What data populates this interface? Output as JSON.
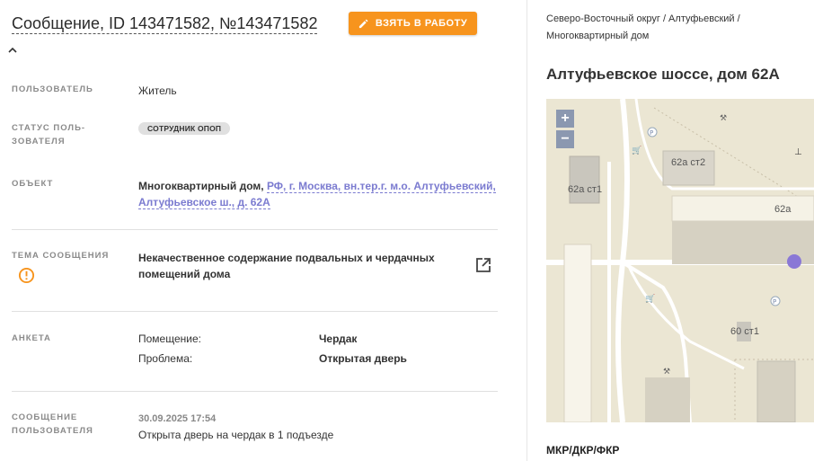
{
  "header": {
    "title": "Сообщение, ID 143471582, №143471582",
    "take_button": "ВЗЯТЬ В РАБОТУ"
  },
  "fields": {
    "user_label": "ПОЛЬЗОВАТЕЛЬ",
    "user_value": "Житель",
    "status_label_1": "СТАТУС ПОЛЬ-",
    "status_label_2": "ЗОВАТЕЛЯ",
    "status_badge": "СОТРУДНИК ОПОП",
    "object_label": "ОБЪЕКТ",
    "object_type": "Многоквартирный дом,",
    "object_link": "РФ, г. Москва, вн.тер.г. м.о. Алтуфьевский, Алтуфьевское ш., д. 62А",
    "theme_label": "ТЕМА СООБЩЕНИЯ",
    "theme_value": "Некачественное содержание подвальных и чердачных помещений дома",
    "anketa_label": "АНКЕТА",
    "anketa_rows": [
      {
        "key": "Помещение:",
        "value": "Чердак"
      },
      {
        "key": "Проблема:",
        "value": "Открытая дверь"
      }
    ],
    "message_label_1": "СООБЩЕНИЕ",
    "message_label_2": "ПОЛЬЗОВАТЕЛЯ",
    "message_date": "30.09.2025 17:54",
    "message_text": "Открыта дверь на чердак в 1 подъезде"
  },
  "sidebar": {
    "breadcrumb_line1": "Северо-Восточный округ / Алтуфьевский /",
    "breadcrumb_line2": "Многоквартирный дом",
    "address": "Алтуфьевское шоссе, дом 62А",
    "map": {
      "zoom_in": "+",
      "zoom_out": "−",
      "labels": [
        "62а ст2",
        "62а ст1",
        "62а",
        "60 ст1"
      ]
    },
    "footer": "МКР/ДКР/ФКР"
  },
  "colors": {
    "accent": "#f7941d",
    "link": "#7b7bd0",
    "warning": "#f7941d",
    "map_marker": "#8a78d6"
  }
}
